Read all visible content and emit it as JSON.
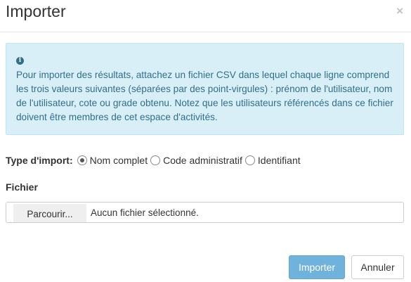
{
  "dialog": {
    "title": "Importer",
    "close_symbol": "×"
  },
  "alert": {
    "icon": "info-icon",
    "icon_glyph": "i",
    "text": "Pour importer des résultats, attachez un fichier CSV dans lequel chaque ligne comprend les trois valeurs suivantes (séparées par des point-virgules) : prénom de l'utilisateur, nom de l'utilisateur, cote ou grade obtenu. Notez que les utilisateurs référencés dans ce fichier doivent être membres de cet espace d'activités."
  },
  "import_type": {
    "label": "Type d'import:",
    "options": [
      {
        "label": "Nom complet",
        "checked": true
      },
      {
        "label": "Code administratif",
        "checked": false
      },
      {
        "label": "Identifiant",
        "checked": false
      }
    ]
  },
  "file": {
    "label": "Fichier",
    "browse_label": "Parcourir...",
    "status": "Aucun fichier sélectionné."
  },
  "footer": {
    "import_label": "Importer",
    "cancel_label": "Annuler"
  },
  "colors": {
    "alert_bg": "#d9eff8",
    "alert_text": "#2f6f89",
    "primary_button": "#6fb2dc"
  }
}
